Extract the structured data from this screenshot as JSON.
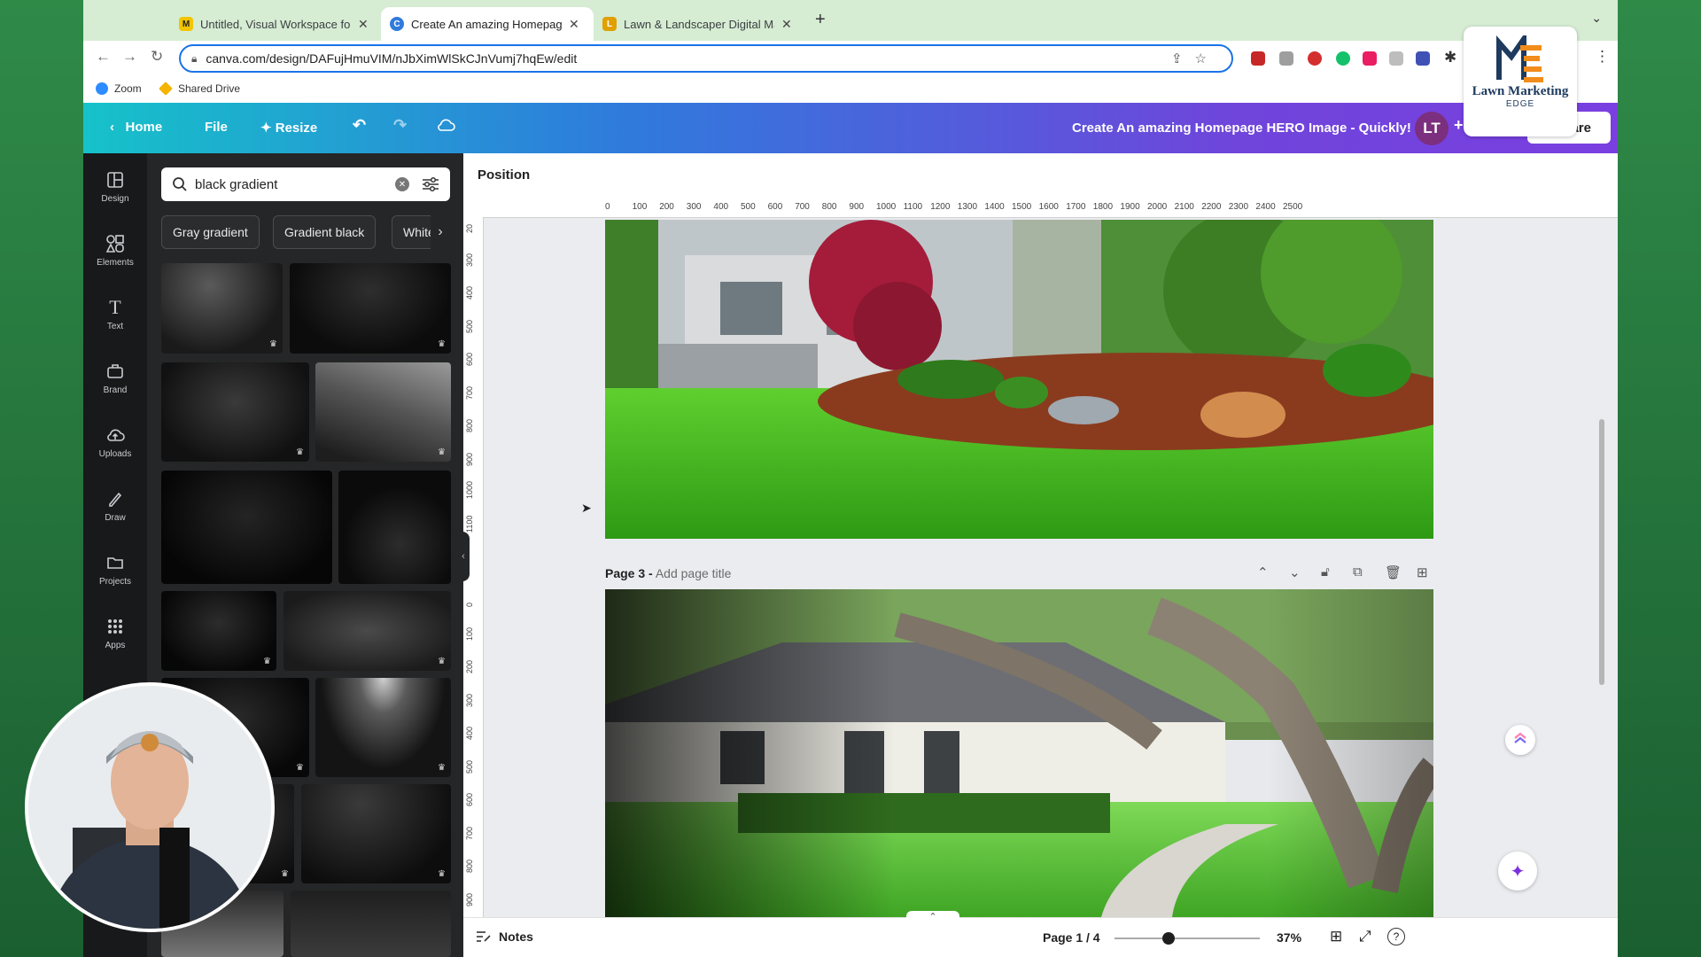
{
  "browser": {
    "tabs": [
      {
        "label": "Untitled, Visual Workspace for",
        "favicon_color": "#f2c500",
        "favicon_glyph": "M"
      },
      {
        "label": "Create An amazing Homepage",
        "favicon_color": "#2f7bdc",
        "favicon_glyph": "C"
      },
      {
        "label": "Lawn & Landscaper Digital Ma",
        "favicon_color": "#e0a000",
        "favicon_glyph": "L"
      }
    ],
    "new_tab_icon": "+",
    "url": "canva.com/design/DAFujHmuVIM/nJbXimWlSkCJnVumj7hqEw/edit",
    "bookmarks": [
      {
        "label": "Zoom",
        "color": "#2d8cff"
      },
      {
        "label": "Shared Drive",
        "color": "#f4b400"
      }
    ]
  },
  "canva": {
    "header": {
      "home": "Home",
      "file": "File",
      "resize": "Resize",
      "title": "Create An amazing Homepage HERO Image - Quickly!",
      "avatar_initials": "LT",
      "share": "Share"
    },
    "logo": {
      "line1": "Lawn Marketing",
      "line2": "EDGE"
    },
    "rail": [
      {
        "label": "Design",
        "icon": "layout-icon"
      },
      {
        "label": "Elements",
        "icon": "shapes-icon"
      },
      {
        "label": "Text",
        "icon": "text-icon"
      },
      {
        "label": "Brand",
        "icon": "briefcase-icon"
      },
      {
        "label": "Uploads",
        "icon": "cloud-upload-icon"
      },
      {
        "label": "Draw",
        "icon": "pen-icon"
      },
      {
        "label": "Projects",
        "icon": "folder-icon"
      },
      {
        "label": "Apps",
        "icon": "grid-icon"
      }
    ],
    "panel": {
      "search_value": "black gradient",
      "chips": [
        "Gray gradient",
        "Gradient black",
        "White gradient"
      ]
    },
    "context_bar": {
      "position": "Position"
    },
    "ruler": {
      "top": [
        "0",
        "100",
        "200",
        "300",
        "400",
        "500",
        "600",
        "700",
        "800",
        "900",
        "1000",
        "1100",
        "1200",
        "1300",
        "1400",
        "1500",
        "1600",
        "1700",
        "1800",
        "1900",
        "2000",
        "2100",
        "2200",
        "2300",
        "2400",
        "2500"
      ],
      "left_upper": [
        "20",
        "300",
        "400",
        "500",
        "600",
        "700",
        "800",
        "900",
        "1000",
        "1100"
      ],
      "left_lower": [
        "0",
        "100",
        "200",
        "300",
        "400",
        "500",
        "600",
        "700",
        "800",
        "900"
      ]
    },
    "page3": {
      "label": "Page 3 -",
      "title_placeholder": "Add page title"
    },
    "footer": {
      "notes": "Notes",
      "page_indicator": "Page 1 / 4",
      "zoom": "37%",
      "zoom_level": 0.37
    }
  }
}
